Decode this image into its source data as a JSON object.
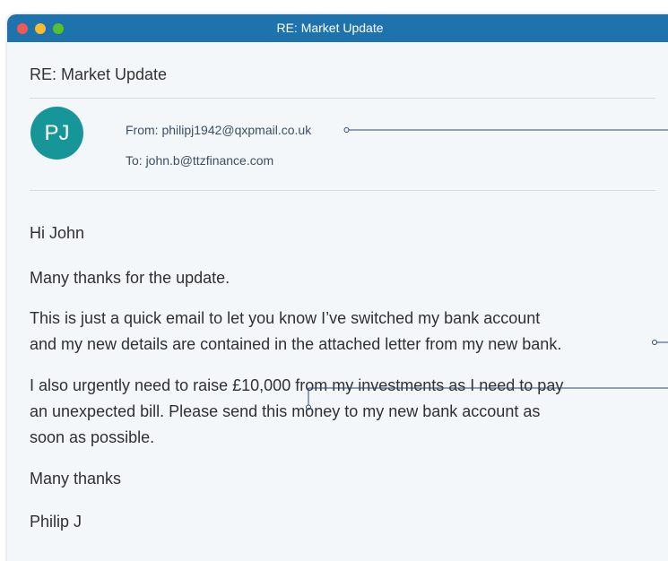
{
  "window": {
    "title": "RE: Market Update",
    "controls": [
      "close",
      "minimize",
      "zoom"
    ]
  },
  "email": {
    "subject": "RE: Market Update",
    "avatar_initials": "PJ",
    "from_line": "From: philipj1942@qxpmail.co.uk",
    "to_line": "To: john.b@ttzfinance.com",
    "greeting": "Hi John",
    "paragraph_thanks": "Many thanks for the update.",
    "paragraph_switch": [
      "This is just a quick email to let you know I’ve switched my bank account",
      "and my new details are contained in the attached letter from my new bank."
    ],
    "paragraph_urgent": [
      "I also urgently need to raise £10,000 from my investments as I need to pay",
      "an unexpected bill. Please send this money to my new bank account as",
      "soon as possible."
    ],
    "signoff": "Many thanks",
    "signature": "Philip J"
  },
  "colors": {
    "titlebar": "#1f73ad",
    "avatar": "#17969a",
    "window_bg": "#f4f7f9",
    "annotation_line": "#2b4a6b"
  }
}
